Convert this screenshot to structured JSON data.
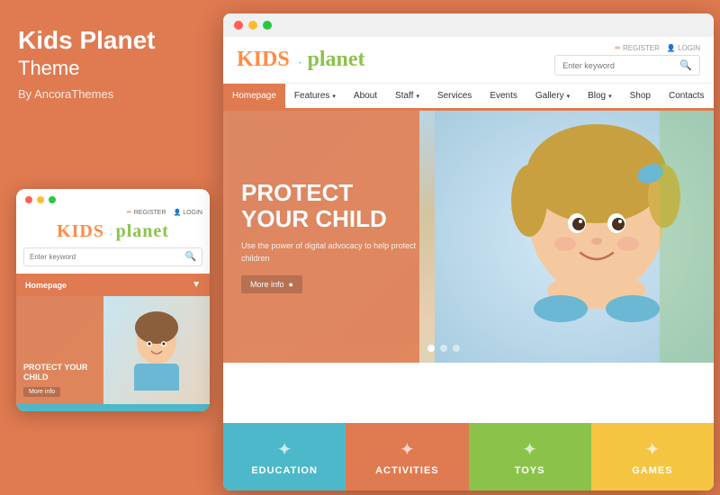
{
  "background_color": "#e07a50",
  "left_panel": {
    "title_line1": "Kids Planet",
    "title_line2": "Theme",
    "author": "By AncoraThemes"
  },
  "mobile": {
    "dots": [
      "red",
      "yellow",
      "green"
    ],
    "register_label": "REGISTER",
    "login_label": "LOGIN",
    "logo_kids": "KIDS",
    "logo_separator": "·",
    "logo_planet": "planet",
    "search_placeholder": "Enter keyword",
    "nav_label": "Homepage",
    "hero_title": "PROTECT YOUR CHILD",
    "hero_btn": "More info"
  },
  "desktop": {
    "dots": [
      "red",
      "yellow",
      "green"
    ],
    "register_label": "REGISTER",
    "login_label": "LOGIN",
    "logo_kids": "KIDS",
    "logo_separator": "·",
    "logo_planet": "planet",
    "search_placeholder": "Enter keyword",
    "nav_items": [
      {
        "label": "Homepage",
        "active": true,
        "has_dropdown": false
      },
      {
        "label": "Features",
        "active": false,
        "has_dropdown": true
      },
      {
        "label": "About",
        "active": false,
        "has_dropdown": false
      },
      {
        "label": "Staff",
        "active": false,
        "has_dropdown": true
      },
      {
        "label": "Services",
        "active": false,
        "has_dropdown": false
      },
      {
        "label": "Events",
        "active": false,
        "has_dropdown": false
      },
      {
        "label": "Gallery",
        "active": false,
        "has_dropdown": true
      },
      {
        "label": "Blog",
        "active": false,
        "has_dropdown": true
      },
      {
        "label": "Shop",
        "active": false,
        "has_dropdown": false
      },
      {
        "label": "Contacts",
        "active": false,
        "has_dropdown": false
      }
    ],
    "hero_title": "PROTECT YOUR CHILD",
    "hero_subtitle": "Use the power of digital advocacy to help protect children",
    "hero_btn": "More info",
    "dots_count": 3,
    "categories": [
      {
        "label": "EDUCATION",
        "class": "education",
        "icon": "✦"
      },
      {
        "label": "ACTIVITIES",
        "class": "activities",
        "icon": "✦"
      },
      {
        "label": "TOYS",
        "class": "toys",
        "icon": "✦"
      },
      {
        "label": "GAMES",
        "class": "games",
        "icon": "✦"
      }
    ]
  }
}
